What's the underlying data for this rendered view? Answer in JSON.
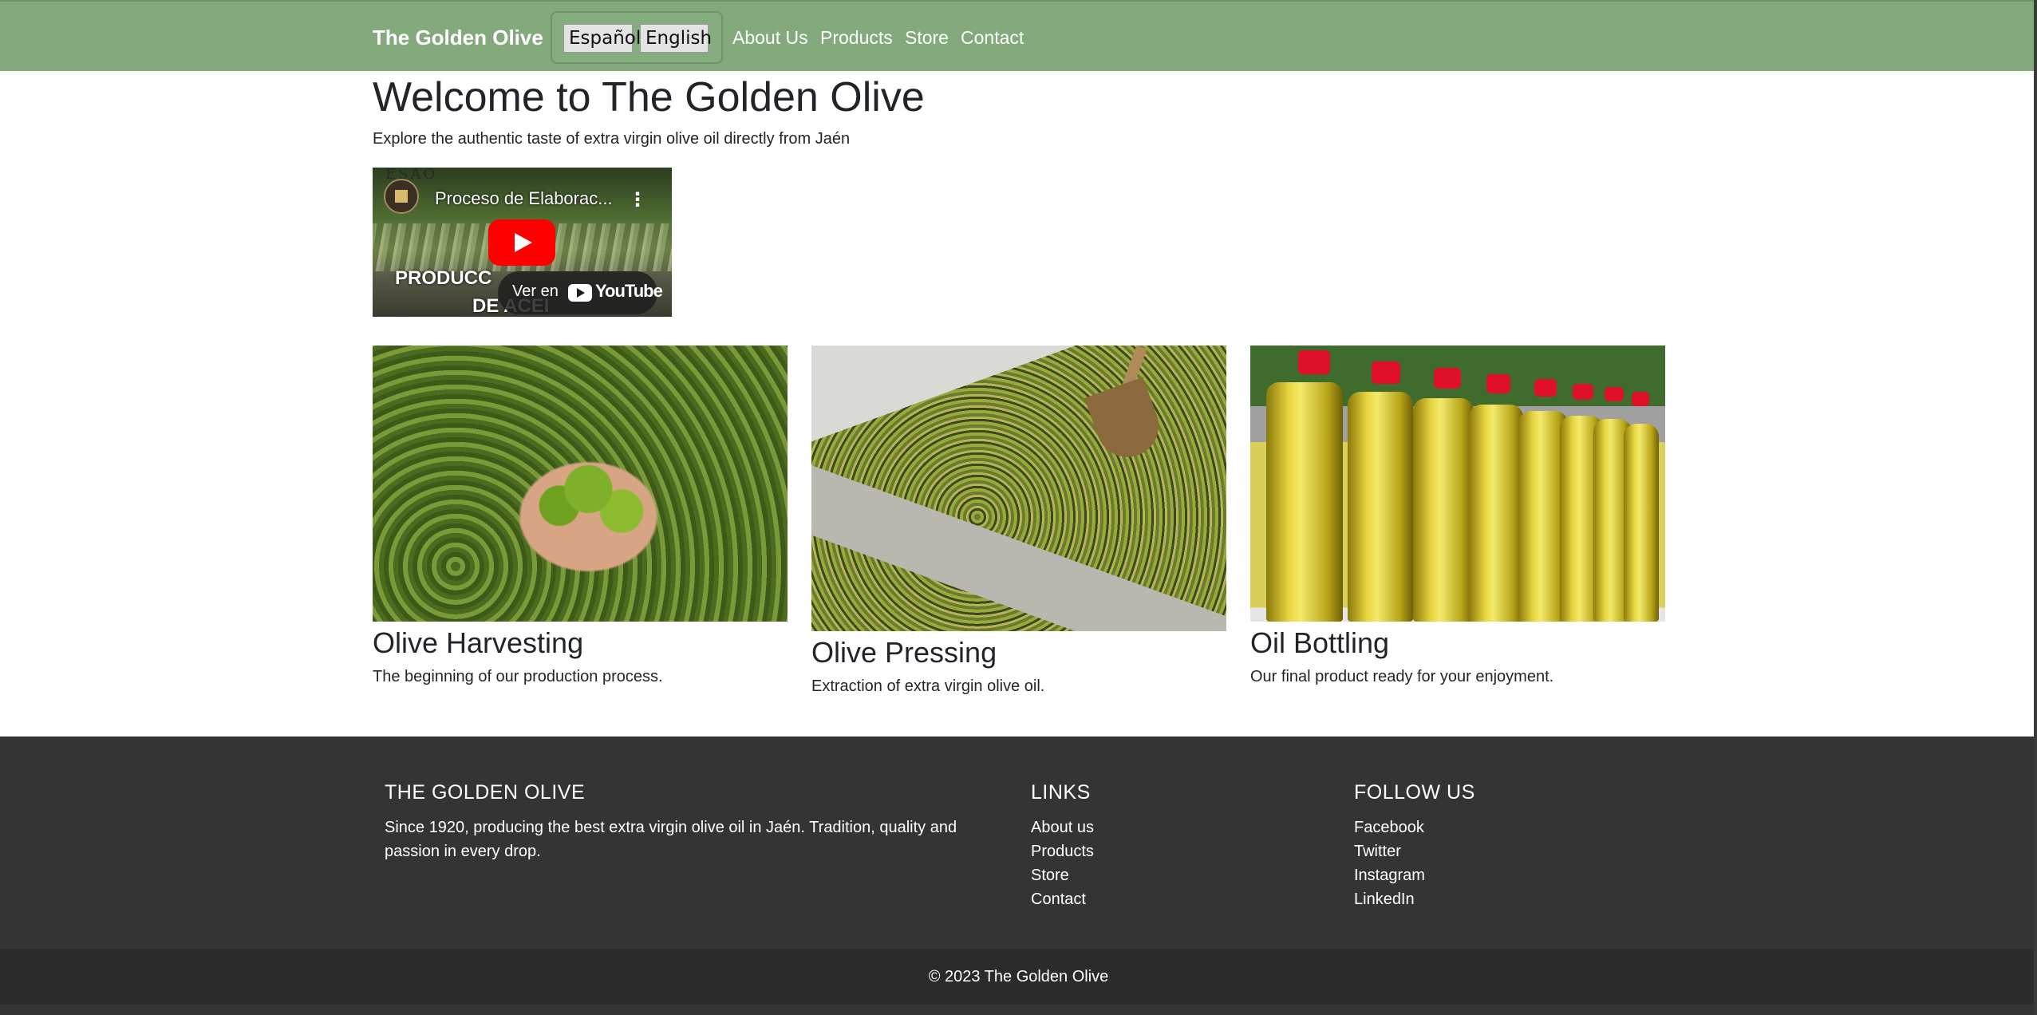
{
  "navbar": {
    "brand": "The Golden Olive",
    "languages": [
      "Español",
      "English"
    ],
    "links": [
      "About Us",
      "Products",
      "Store",
      "Contact"
    ]
  },
  "hero": {
    "title": "Welcome to The Golden Olive",
    "subtitle": "Explore the authentic taste of extra virgin olive oil directly from Jaén"
  },
  "video": {
    "title": "Proceso de Elaborac...",
    "watch_label": "Ver en",
    "platform": "YouTube",
    "overlay_line1": "PRODUCC",
    "overlay_line2": "DE ACEI",
    "logo_text": "ESAO"
  },
  "cards": [
    {
      "title": "Olive Harvesting",
      "text": "The beginning of our production process."
    },
    {
      "title": "Olive Pressing",
      "text": "Extraction of extra virgin olive oil."
    },
    {
      "title": "Oil Bottling",
      "text": "Our final product ready for your enjoyment."
    }
  ],
  "footer": {
    "about_heading": "THE GOLDEN OLIVE",
    "about_text": "Since 1920, producing the best extra virgin olive oil in Jaén. Tradition, quality and passion in every drop.",
    "links_heading": "LINKS",
    "links": [
      "About us",
      "Products",
      "Store",
      "Contact"
    ],
    "follow_heading": "FOLLOW US",
    "social": [
      "Facebook",
      "Twitter",
      "Instagram",
      "LinkedIn"
    ],
    "copyright": "© 2023 The Golden Olive"
  },
  "colors": {
    "navbar": "#83a97c",
    "footer": "#343434",
    "copyright_bar": "#2b2b2b",
    "youtube_red": "#ff0000"
  },
  "icons": [
    "youtube-play-icon",
    "more-options-icon",
    "youtube-logo-icon"
  ]
}
